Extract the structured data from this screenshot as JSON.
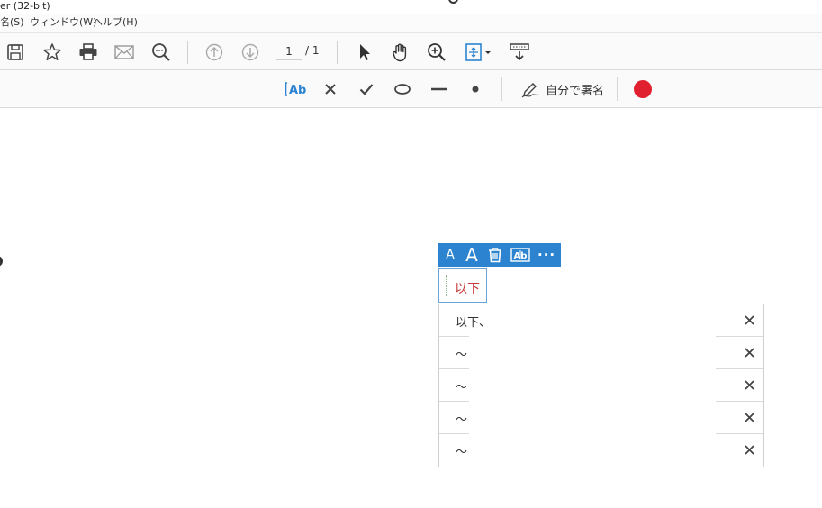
{
  "window": {
    "title": "er (32-bit)"
  },
  "menu": [
    {
      "label": "名(S)"
    },
    {
      "label": "ウィンドウ(W)"
    },
    {
      "label": "ヘルプ(H)"
    }
  ],
  "toolbar": {
    "icons": [
      "save-icon",
      "star-icon",
      "print-icon",
      "mail-icon",
      "find-icon",
      "page-up-icon",
      "page-down-icon",
      "select-cursor-icon",
      "hand-icon",
      "zoom-in-icon",
      "fit-page-icon",
      "scroll-mode-icon"
    ],
    "page_current": "1",
    "page_total": "/ 1"
  },
  "signbar": {
    "icons": [
      "add-text-icon",
      "cross-mark-icon",
      "check-mark-icon",
      "ellipse-icon",
      "line-icon",
      "dot-icon",
      "sign-pen-icon"
    ],
    "self_sign_label": "自分で署名",
    "color_value": "#e0202e"
  },
  "format_toolbar": {
    "small_a": "A",
    "large_a": "A",
    "more": "···"
  },
  "text_field": {
    "value": "以下"
  },
  "suggestions": [
    {
      "text": "以下、"
    },
    {
      "text": "～"
    },
    {
      "text": "～"
    },
    {
      "text": "～"
    },
    {
      "text": "～"
    }
  ]
}
